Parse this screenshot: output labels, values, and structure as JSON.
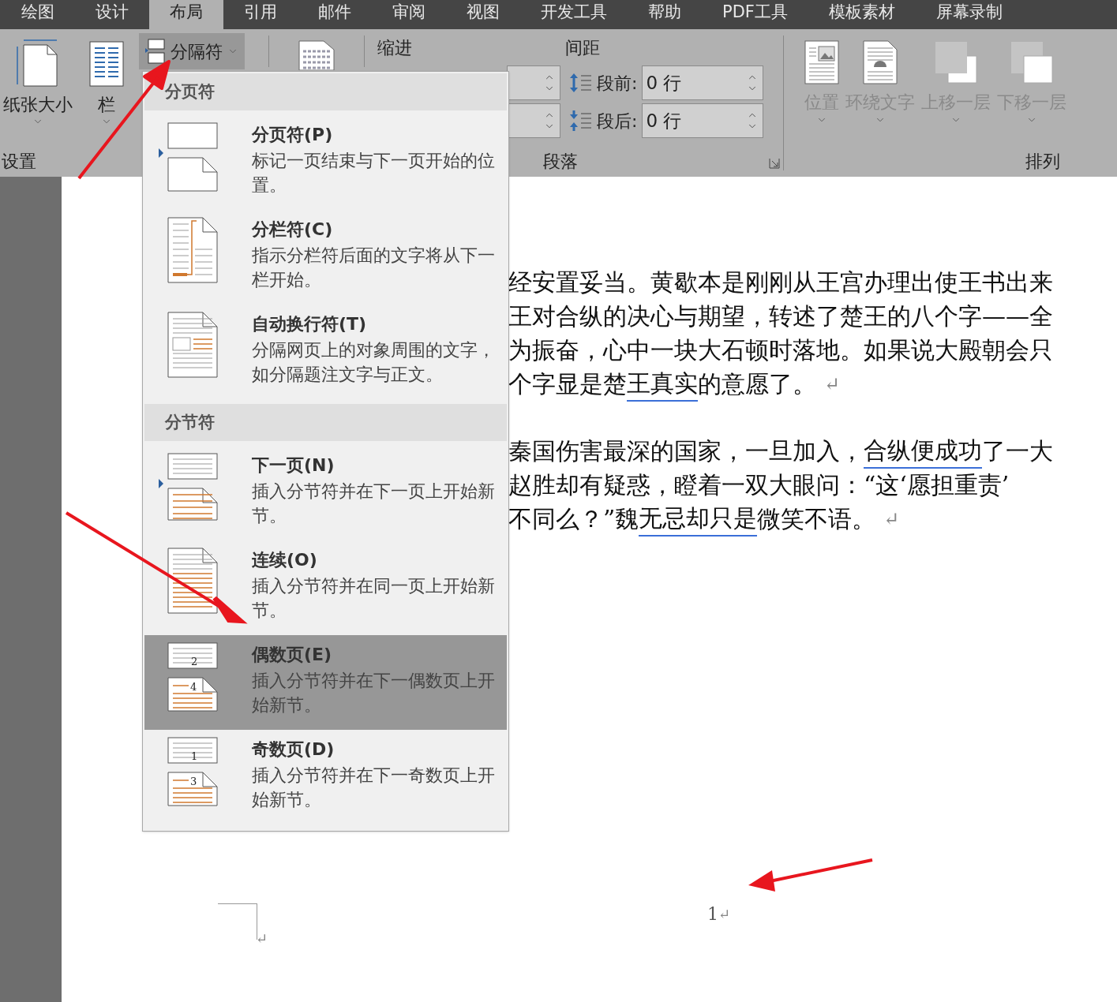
{
  "tabs": [
    {
      "label": "绘图",
      "selected": false
    },
    {
      "label": "设计",
      "selected": false
    },
    {
      "label": "布局",
      "selected": true
    },
    {
      "label": "引用",
      "selected": false
    },
    {
      "label": "邮件",
      "selected": false
    },
    {
      "label": "审阅",
      "selected": false
    },
    {
      "label": "视图",
      "selected": false
    },
    {
      "label": "开发工具",
      "selected": false
    },
    {
      "label": "帮助",
      "selected": false
    },
    {
      "label": "PDF工具",
      "selected": false
    },
    {
      "label": "模板素材",
      "selected": false
    },
    {
      "label": "屏幕录制",
      "selected": false
    }
  ],
  "ribbon": {
    "page_setup": {
      "items": [
        {
          "kind": "size",
          "label": "纸张大小"
        },
        {
          "kind": "columns",
          "label": "栏"
        }
      ],
      "breaks_button": {
        "label": "分隔符",
        "expanded": true
      },
      "group_label": "设置"
    },
    "paragraph": {
      "indent_label": "缩进",
      "spacing_label": "间距",
      "spacing": [
        {
          "kind": "before",
          "label": "段前:",
          "value": "0 行"
        },
        {
          "kind": "after",
          "label": "段后:",
          "value": "0 行"
        }
      ],
      "group_label": "段落"
    },
    "arrange": {
      "items": [
        {
          "kind": "position",
          "label": "位置",
          "disabled": true
        },
        {
          "kind": "wrap",
          "label": "环绕文字",
          "disabled": true
        },
        {
          "kind": "forward",
          "label": "上移一层",
          "disabled": true
        },
        {
          "kind": "backward",
          "label": "下移一层",
          "disabled": true
        }
      ],
      "group_label": "排列"
    }
  },
  "breaks_menu": {
    "sections": [
      {
        "heading": "分页符",
        "items": [
          {
            "kind": "page",
            "title": "分页符(P)",
            "description": "标记一页结束与下一页开始的位置。",
            "selected": false
          },
          {
            "kind": "column",
            "title": "分栏符(C)",
            "description": "指示分栏符后面的文字将从下一栏开始。",
            "selected": false
          },
          {
            "kind": "wrapping",
            "title": "自动换行符(T)",
            "description": "分隔网页上的对象周围的文字，如分隔题注文字与正文。",
            "selected": false
          }
        ]
      },
      {
        "heading": "分节符",
        "items": [
          {
            "kind": "next_page",
            "title": "下一页(N)",
            "description": "插入分节符并在下一页上开始新节。",
            "selected": false
          },
          {
            "kind": "continuous",
            "title": "连续(O)",
            "description": "插入分节符并在同一页上开始新节。",
            "selected": false
          },
          {
            "kind": "even",
            "title": "偶数页(E)",
            "description": "插入分节符并在下一偶数页上开始新节。",
            "selected": true,
            "icon_labels": [
              "2",
              "4"
            ]
          },
          {
            "kind": "odd",
            "title": "奇数页(D)",
            "description": "插入分节符并在下一奇数页上开始新节。",
            "selected": false,
            "icon_labels": [
              "1",
              "3"
            ]
          }
        ]
      }
    ]
  },
  "document": {
    "paragraphs": [
      {
        "lines": [
          {
            "segments": [
              {
                "text": "经安置妥当。黄歇本是刚刚从王宫办理出使王书出来",
                "underline": false
              }
            ]
          },
          {
            "segments": [
              {
                "text": "王对合纵的决心与期望，转述了楚王的八个字——全",
                "underline": false
              }
            ]
          },
          {
            "segments": [
              {
                "text": "为振奋，心中一块大石顿时落地。如果说大殿朝会只",
                "underline": false
              }
            ]
          },
          {
            "segments": [
              {
                "text": "个字显是楚",
                "underline": false
              },
              {
                "text": "王真实",
                "underline": true
              },
              {
                "text": "的意愿了。",
                "underline": false
              }
            ]
          }
        ],
        "mark": "↵"
      },
      {
        "lines": [
          {
            "segments": [
              {
                "text": "秦国伤害最深的国家，一旦加入，",
                "underline": false
              },
              {
                "text": "合纵便成功",
                "underline": true
              },
              {
                "text": "了一大",
                "underline": false
              }
            ]
          },
          {
            "segments": [
              {
                "text": "赵胜却有疑惑，瞪着一双大眼问：“这‘愿担重责’",
                "underline": false
              }
            ]
          },
          {
            "segments": [
              {
                "text": "不同么？”魏",
                "underline": false
              },
              {
                "text": "无忌却只是",
                "underline": true
              },
              {
                "text": "微笑不语。",
                "underline": false
              }
            ]
          }
        ],
        "mark": "↵"
      }
    ],
    "footer_mark": "↵",
    "page_number": "1",
    "page_number_mark": "↵"
  }
}
